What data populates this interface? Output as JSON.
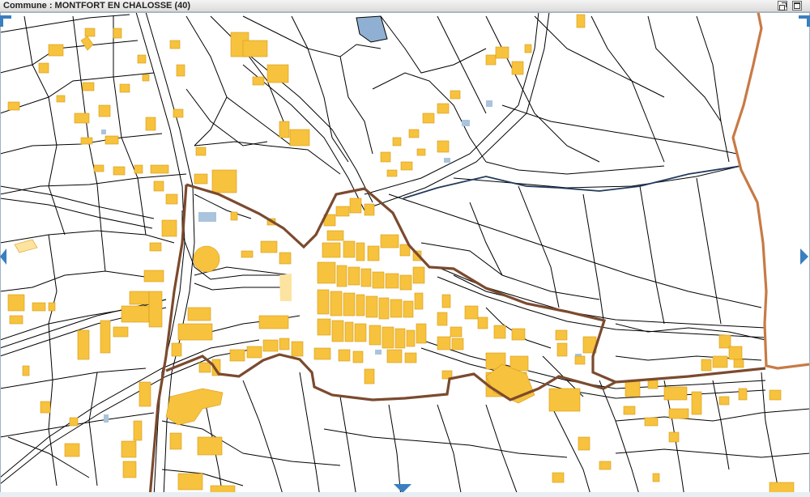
{
  "window": {
    "title": "Commune : MONTFORT EN CHALOSSE (40)",
    "restore_icon": "restore-window-icon",
    "maximize_icon": "maximize-window-icon"
  },
  "map": {
    "type": "cadastral-parcel-map",
    "colors": {
      "background": "#ffffff",
      "parcel_line": "#000000",
      "building": "#f7c23d",
      "building_outline": "#d69a12",
      "water_or_annex": "#a9c4dc",
      "pond": "#8fb0d2",
      "town_boundary": "#7b4a2e",
      "commune_boundary": "#c87a45",
      "stream": "#213a5c",
      "pan_arrow": "#3a7fc0"
    },
    "pan_controls": [
      "pan-up-arrow-icon",
      "pan-down-arrow-icon",
      "pan-left-arrow-icon",
      "pan-right-arrow-icon"
    ]
  }
}
